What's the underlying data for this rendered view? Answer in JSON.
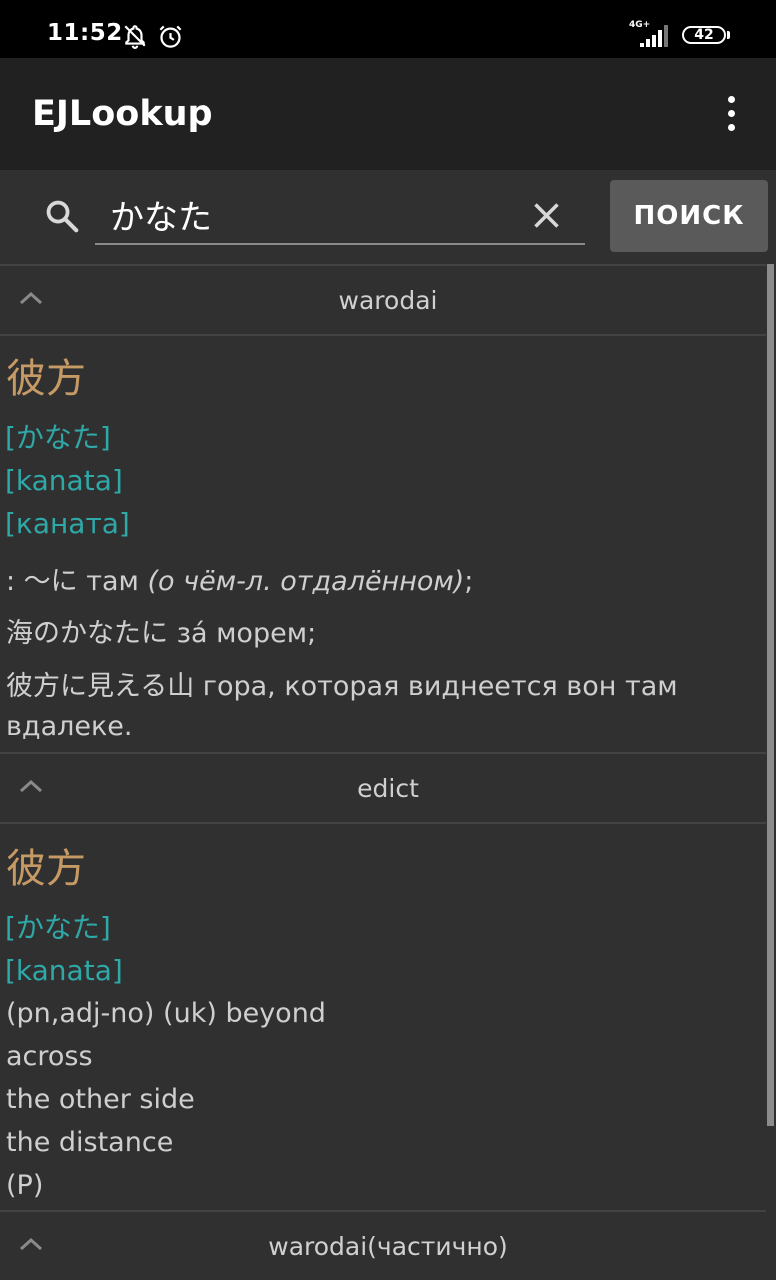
{
  "status_bar": {
    "time": "11:52",
    "network": "4G+",
    "battery": "42",
    "icons": [
      "notifications-off-icon",
      "alarm-icon",
      "signal-icon",
      "battery-icon"
    ]
  },
  "app_bar": {
    "title": "EJLookup",
    "menu_icon": "more-vert-icon"
  },
  "search": {
    "query": "かなた",
    "button_label": "ПОИСК",
    "icons": [
      "search-icon",
      "clear-icon"
    ]
  },
  "sections": [
    {
      "title": "warodai",
      "kanji": "彼方",
      "readings": [
        "[かなた]",
        "[kanata]",
        "[каната]"
      ],
      "definitions": [
        {
          "text": ": 〜に там ",
          "italic": "(о чём-л. отдалённом)",
          "tail": ";"
        },
        {
          "text": "海のかなたに за́ морем;"
        },
        {
          "text": "彼方に見える山 гора, которая виднеется вон там"
        },
        {
          "text": "вдалеке."
        }
      ]
    },
    {
      "title": "edict",
      "kanji": "彼方",
      "readings": [
        "[かなた]",
        "[kanata]"
      ],
      "definitions": [
        {
          "text": "(pn,adj-no) (uk) beyond"
        },
        {
          "text": "across"
        },
        {
          "text": "the other side"
        },
        {
          "text": "the distance"
        },
        {
          "text": "(P)"
        }
      ]
    },
    {
      "title": "warodai(частично)"
    }
  ],
  "colors": {
    "background": "#303030",
    "app_bar": "#212121",
    "kanji": "#c69a64",
    "reading": "#2fa8a8",
    "text": "#cfcfcf"
  }
}
